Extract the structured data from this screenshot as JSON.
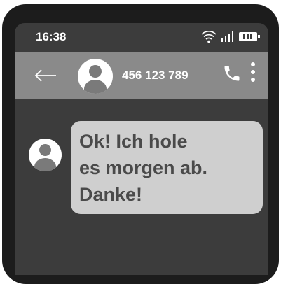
{
  "status_bar": {
    "time": "16:38",
    "icons": [
      "wifi-icon",
      "signal-icon",
      "battery-icon"
    ]
  },
  "header": {
    "back_icon": "arrow-left-icon",
    "contact_number": "456 123 789",
    "call_icon": "phone-icon",
    "menu_icon": "more-vertical-icon"
  },
  "message": {
    "text_lines": [
      "Ok! Ich hole",
      "es morgen ab.",
      "Danke!"
    ]
  },
  "colors": {
    "screen_bg": "#3c3c3c",
    "header_bg": "#8a8a8a",
    "bubble_bg": "#cfcfcf",
    "bubble_text": "#4a4a4a",
    "phone_frame": "#1c1c1c"
  }
}
